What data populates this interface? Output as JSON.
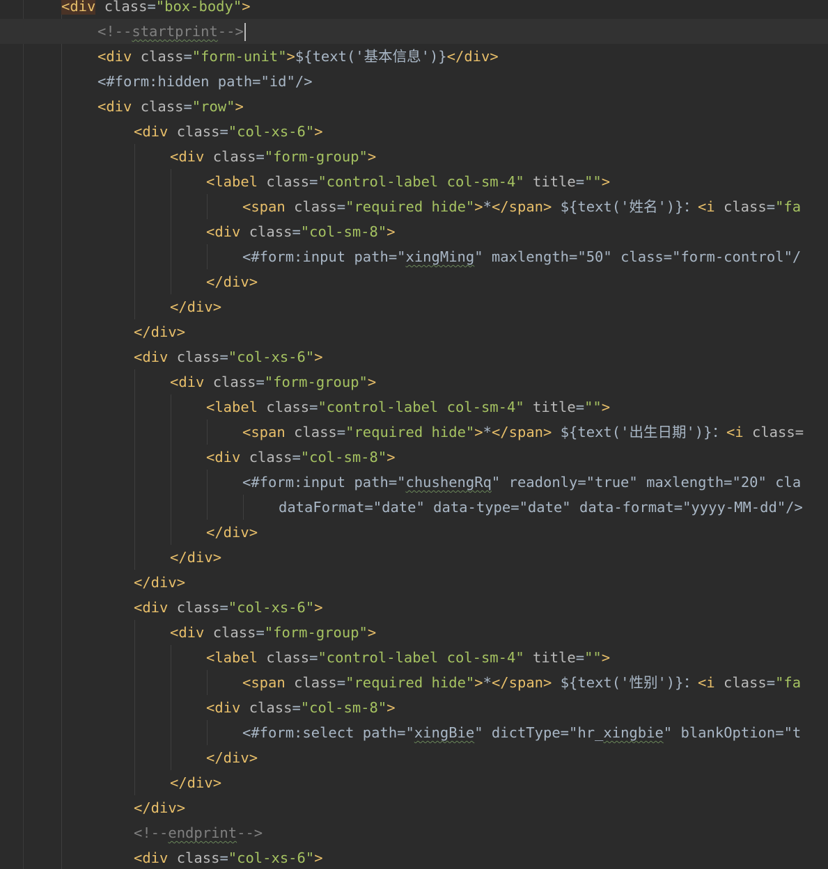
{
  "editor": {
    "language": "html-freemarker",
    "colors": {
      "background": "#2b2b2b",
      "current_line": "#323232",
      "tag": "#e8bf6a",
      "attribute": "#bababa",
      "string": "#a5c261",
      "text": "#a9b7c6",
      "comment": "#808080"
    },
    "lines": [
      {
        "indent": 1,
        "tokens": [
          {
            "t": "<div",
            "c": "tag-hl"
          },
          {
            "t": " "
          },
          {
            "t": "class",
            "c": "attr"
          },
          {
            "t": "=",
            "c": "plain"
          },
          {
            "t": "\"box-body\"",
            "c": "str"
          },
          {
            "t": ">",
            "c": "tag"
          }
        ]
      },
      {
        "indent": 2,
        "current": true,
        "caret": true,
        "tokens": [
          {
            "t": "<!--",
            "c": "comment"
          },
          {
            "t": "startprint",
            "c": "comment",
            "wavy": true
          },
          {
            "t": "-->",
            "c": "comment"
          }
        ]
      },
      {
        "indent": 2,
        "tokens": [
          {
            "t": "<div",
            "c": "tag"
          },
          {
            "t": " "
          },
          {
            "t": "class",
            "c": "attr"
          },
          {
            "t": "=",
            "c": "plain"
          },
          {
            "t": "\"form-unit\"",
            "c": "str"
          },
          {
            "t": ">",
            "c": "tag"
          },
          {
            "t": "${text('基本信息')}",
            "c": "plain"
          },
          {
            "t": "</div>",
            "c": "tag"
          }
        ]
      },
      {
        "indent": 2,
        "tokens": [
          {
            "t": "<#form:hidden path=\"id\"/>",
            "c": "plain"
          }
        ]
      },
      {
        "indent": 2,
        "tokens": [
          {
            "t": "<div",
            "c": "tag"
          },
          {
            "t": " "
          },
          {
            "t": "class",
            "c": "attr"
          },
          {
            "t": "=",
            "c": "plain"
          },
          {
            "t": "\"row\"",
            "c": "str"
          },
          {
            "t": ">",
            "c": "tag"
          }
        ]
      },
      {
        "indent": 3,
        "tokens": [
          {
            "t": "<div",
            "c": "tag"
          },
          {
            "t": " "
          },
          {
            "t": "class",
            "c": "attr"
          },
          {
            "t": "=",
            "c": "plain"
          },
          {
            "t": "\"col-xs-6\"",
            "c": "str"
          },
          {
            "t": ">",
            "c": "tag"
          }
        ]
      },
      {
        "indent": 4,
        "tokens": [
          {
            "t": "<div",
            "c": "tag"
          },
          {
            "t": " "
          },
          {
            "t": "class",
            "c": "attr"
          },
          {
            "t": "=",
            "c": "plain"
          },
          {
            "t": "\"form-group\"",
            "c": "str"
          },
          {
            "t": ">",
            "c": "tag"
          }
        ]
      },
      {
        "indent": 5,
        "tokens": [
          {
            "t": "<label",
            "c": "tag"
          },
          {
            "t": " "
          },
          {
            "t": "class",
            "c": "attr"
          },
          {
            "t": "=",
            "c": "plain"
          },
          {
            "t": "\"control-label col-sm-4\"",
            "c": "str"
          },
          {
            "t": " "
          },
          {
            "t": "title",
            "c": "attr"
          },
          {
            "t": "=",
            "c": "plain"
          },
          {
            "t": "\"\"",
            "c": "str"
          },
          {
            "t": ">",
            "c": "tag"
          }
        ]
      },
      {
        "indent": 6,
        "tokens": [
          {
            "t": "<span",
            "c": "tag"
          },
          {
            "t": " "
          },
          {
            "t": "class",
            "c": "attr"
          },
          {
            "t": "=",
            "c": "plain"
          },
          {
            "t": "\"required hide\"",
            "c": "str"
          },
          {
            "t": ">",
            "c": "tag"
          },
          {
            "t": "*",
            "c": "plain"
          },
          {
            "t": "</span>",
            "c": "tag"
          },
          {
            "t": " ${text('姓名')}：",
            "c": "plain"
          },
          {
            "t": "<i",
            "c": "tag"
          },
          {
            "t": " "
          },
          {
            "t": "class",
            "c": "attr"
          },
          {
            "t": "=",
            "c": "plain"
          },
          {
            "t": "\"fa",
            "c": "str"
          }
        ]
      },
      {
        "indent": 5,
        "tokens": [
          {
            "t": "<div",
            "c": "tag"
          },
          {
            "t": " "
          },
          {
            "t": "class",
            "c": "attr"
          },
          {
            "t": "=",
            "c": "plain"
          },
          {
            "t": "\"col-sm-8\"",
            "c": "str"
          },
          {
            "t": ">",
            "c": "tag"
          }
        ]
      },
      {
        "indent": 6,
        "tokens": [
          {
            "t": "<#form:input path=\"",
            "c": "plain"
          },
          {
            "t": "xingMing",
            "c": "plain",
            "wavy": true
          },
          {
            "t": "\" maxlength=\"50\" class=\"form-control\"/",
            "c": "plain"
          }
        ]
      },
      {
        "indent": 5,
        "tokens": [
          {
            "t": "</div>",
            "c": "tag"
          }
        ]
      },
      {
        "indent": 4,
        "tokens": [
          {
            "t": "</div>",
            "c": "tag"
          }
        ]
      },
      {
        "indent": 3,
        "tokens": [
          {
            "t": "</div>",
            "c": "tag"
          }
        ]
      },
      {
        "indent": 3,
        "tokens": [
          {
            "t": "<div",
            "c": "tag"
          },
          {
            "t": " "
          },
          {
            "t": "class",
            "c": "attr"
          },
          {
            "t": "=",
            "c": "plain"
          },
          {
            "t": "\"col-xs-6\"",
            "c": "str"
          },
          {
            "t": ">",
            "c": "tag"
          }
        ]
      },
      {
        "indent": 4,
        "tokens": [
          {
            "t": "<div",
            "c": "tag"
          },
          {
            "t": " "
          },
          {
            "t": "class",
            "c": "attr"
          },
          {
            "t": "=",
            "c": "plain"
          },
          {
            "t": "\"form-group\"",
            "c": "str"
          },
          {
            "t": ">",
            "c": "tag"
          }
        ]
      },
      {
        "indent": 5,
        "tokens": [
          {
            "t": "<label",
            "c": "tag"
          },
          {
            "t": " "
          },
          {
            "t": "class",
            "c": "attr"
          },
          {
            "t": "=",
            "c": "plain"
          },
          {
            "t": "\"control-label col-sm-4\"",
            "c": "str"
          },
          {
            "t": " "
          },
          {
            "t": "title",
            "c": "attr"
          },
          {
            "t": "=",
            "c": "plain"
          },
          {
            "t": "\"\"",
            "c": "str"
          },
          {
            "t": ">",
            "c": "tag"
          }
        ]
      },
      {
        "indent": 6,
        "tokens": [
          {
            "t": "<span",
            "c": "tag"
          },
          {
            "t": " "
          },
          {
            "t": "class",
            "c": "attr"
          },
          {
            "t": "=",
            "c": "plain"
          },
          {
            "t": "\"required hide\"",
            "c": "str"
          },
          {
            "t": ">",
            "c": "tag"
          },
          {
            "t": "*",
            "c": "plain"
          },
          {
            "t": "</span>",
            "c": "tag"
          },
          {
            "t": " ${text('出生日期')}：",
            "c": "plain"
          },
          {
            "t": "<i",
            "c": "tag"
          },
          {
            "t": " "
          },
          {
            "t": "class=",
            "c": "attr"
          }
        ]
      },
      {
        "indent": 5,
        "tokens": [
          {
            "t": "<div",
            "c": "tag"
          },
          {
            "t": " "
          },
          {
            "t": "class",
            "c": "attr"
          },
          {
            "t": "=",
            "c": "plain"
          },
          {
            "t": "\"col-sm-8\"",
            "c": "str"
          },
          {
            "t": ">",
            "c": "tag"
          }
        ]
      },
      {
        "indent": 6,
        "tokens": [
          {
            "t": "<#form:input path=\"",
            "c": "plain"
          },
          {
            "t": "chushengRq",
            "c": "plain",
            "wavy": true
          },
          {
            "t": "\" readonly=\"true\" maxlength=\"20\" cla",
            "c": "plain"
          }
        ]
      },
      {
        "indent": 7,
        "tokens": [
          {
            "t": "dataFormat=\"date\" data-type=\"date\" data-format=\"yyyy-MM-dd\"/>",
            "c": "plain"
          }
        ]
      },
      {
        "indent": 5,
        "tokens": [
          {
            "t": "</div>",
            "c": "tag"
          }
        ]
      },
      {
        "indent": 4,
        "tokens": [
          {
            "t": "</div>",
            "c": "tag"
          }
        ]
      },
      {
        "indent": 3,
        "tokens": [
          {
            "t": "</div>",
            "c": "tag"
          }
        ]
      },
      {
        "indent": 3,
        "tokens": [
          {
            "t": "<div",
            "c": "tag"
          },
          {
            "t": " "
          },
          {
            "t": "class",
            "c": "attr"
          },
          {
            "t": "=",
            "c": "plain"
          },
          {
            "t": "\"col-xs-6\"",
            "c": "str"
          },
          {
            "t": ">",
            "c": "tag"
          }
        ]
      },
      {
        "indent": 4,
        "tokens": [
          {
            "t": "<div",
            "c": "tag"
          },
          {
            "t": " "
          },
          {
            "t": "class",
            "c": "attr"
          },
          {
            "t": "=",
            "c": "plain"
          },
          {
            "t": "\"form-group\"",
            "c": "str"
          },
          {
            "t": ">",
            "c": "tag"
          }
        ]
      },
      {
        "indent": 5,
        "tokens": [
          {
            "t": "<label",
            "c": "tag"
          },
          {
            "t": " "
          },
          {
            "t": "class",
            "c": "attr"
          },
          {
            "t": "=",
            "c": "plain"
          },
          {
            "t": "\"control-label col-sm-4\"",
            "c": "str"
          },
          {
            "t": " "
          },
          {
            "t": "title",
            "c": "attr"
          },
          {
            "t": "=",
            "c": "plain"
          },
          {
            "t": "\"\"",
            "c": "str"
          },
          {
            "t": ">",
            "c": "tag"
          }
        ]
      },
      {
        "indent": 6,
        "tokens": [
          {
            "t": "<span",
            "c": "tag"
          },
          {
            "t": " "
          },
          {
            "t": "class",
            "c": "attr"
          },
          {
            "t": "=",
            "c": "plain"
          },
          {
            "t": "\"required hide\"",
            "c": "str"
          },
          {
            "t": ">",
            "c": "tag"
          },
          {
            "t": "*",
            "c": "plain"
          },
          {
            "t": "</span>",
            "c": "tag"
          },
          {
            "t": " ${text('性别')}：",
            "c": "plain"
          },
          {
            "t": "<i",
            "c": "tag"
          },
          {
            "t": " "
          },
          {
            "t": "class",
            "c": "attr"
          },
          {
            "t": "=",
            "c": "plain"
          },
          {
            "t": "\"fa",
            "c": "str"
          }
        ]
      },
      {
        "indent": 5,
        "tokens": [
          {
            "t": "<div",
            "c": "tag"
          },
          {
            "t": " "
          },
          {
            "t": "class",
            "c": "attr"
          },
          {
            "t": "=",
            "c": "plain"
          },
          {
            "t": "\"col-sm-8\"",
            "c": "str"
          },
          {
            "t": ">",
            "c": "tag"
          }
        ]
      },
      {
        "indent": 6,
        "tokens": [
          {
            "t": "<#form:select path=\"",
            "c": "plain"
          },
          {
            "t": "xingBie",
            "c": "plain",
            "wavy": true
          },
          {
            "t": "\" dictType=\"hr_",
            "c": "plain"
          },
          {
            "t": "xingbie",
            "c": "plain",
            "wavy": true
          },
          {
            "t": "\" blankOption=\"t",
            "c": "plain"
          }
        ]
      },
      {
        "indent": 5,
        "tokens": [
          {
            "t": "</div>",
            "c": "tag"
          }
        ]
      },
      {
        "indent": 4,
        "tokens": [
          {
            "t": "</div>",
            "c": "tag"
          }
        ]
      },
      {
        "indent": 3,
        "tokens": [
          {
            "t": "</div>",
            "c": "tag"
          }
        ]
      },
      {
        "indent": 3,
        "tokens": [
          {
            "t": "<!--",
            "c": "comment"
          },
          {
            "t": "endprint",
            "c": "comment",
            "wavy": true
          },
          {
            "t": "-->",
            "c": "comment"
          }
        ]
      },
      {
        "indent": 3,
        "tokens": [
          {
            "t": "<div",
            "c": "tag"
          },
          {
            "t": " "
          },
          {
            "t": "class",
            "c": "attr"
          },
          {
            "t": "=",
            "c": "plain"
          },
          {
            "t": "\"col-xs-6\"",
            "c": "str"
          },
          {
            "t": ">",
            "c": "tag"
          }
        ]
      }
    ]
  }
}
